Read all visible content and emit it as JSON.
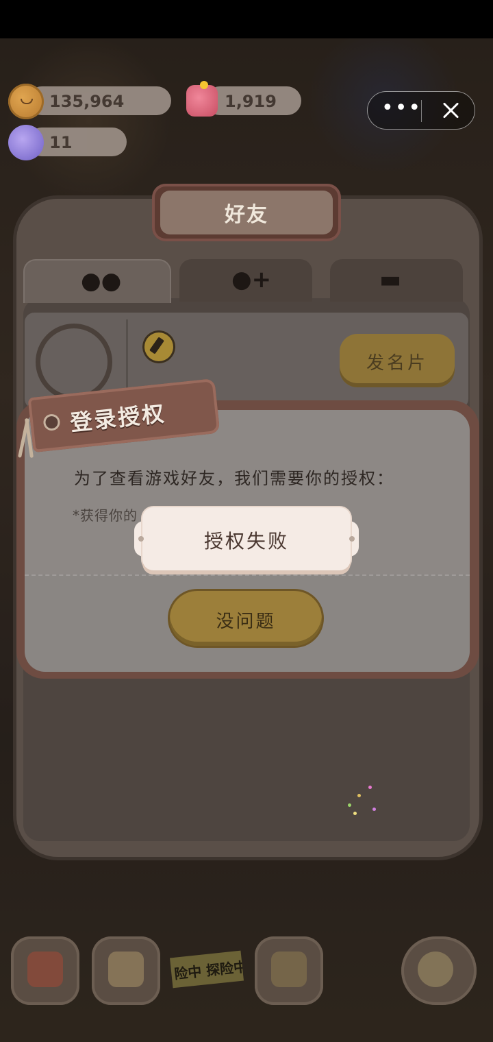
{
  "resources": {
    "cookies": "135,964",
    "jelly": "1,919",
    "crystals": "11"
  },
  "capsule": {
    "more_icon": "more-dots-icon",
    "close_icon": "close-icon"
  },
  "friends_panel": {
    "title": "好友",
    "tabs": [
      {
        "icon": "friends-icon",
        "active": true
      },
      {
        "icon": "add-friend-icon",
        "active": false
      },
      {
        "icon": "briefcase-icon",
        "active": false
      }
    ],
    "send_card_label": "发名片"
  },
  "auth_dialog": {
    "title": "登录授权",
    "message": "为了查看游戏好友，我们需要你的授权：",
    "detail": "*获得你的",
    "ok_label": "没问题"
  },
  "toast": {
    "text": "授权失败"
  },
  "dock": {
    "tape_text": "险中 探险中"
  },
  "colors": {
    "dialog_frame": "#6e4c42",
    "button_gold": "#9c7f3a",
    "toast_bg": "#f5ebe5"
  }
}
